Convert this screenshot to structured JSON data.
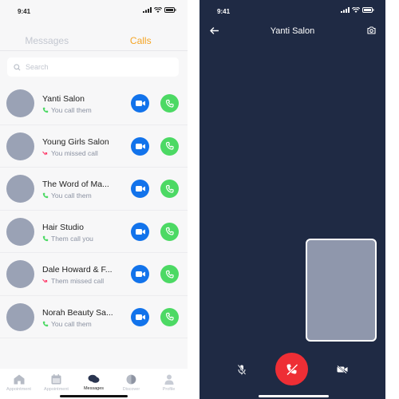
{
  "left_screen": {
    "status_time": "9:41",
    "tabs": [
      {
        "label": "Messages",
        "active": false
      },
      {
        "label": "Calls",
        "active": true
      }
    ],
    "search": {
      "placeholder": "Search",
      "value": ""
    },
    "calls": [
      {
        "name": "Yanti Salon",
        "status": "You call them",
        "direction": "outgoing"
      },
      {
        "name": "Young Girls Salon",
        "status": "You missed call",
        "direction": "missed"
      },
      {
        "name": "The Word of Ma...",
        "status": "You call them",
        "direction": "outgoing"
      },
      {
        "name": "Hair Studio",
        "status": "Them call you",
        "direction": "incoming"
      },
      {
        "name": "Dale Howard & F...",
        "status": "Them missed call",
        "direction": "missed"
      },
      {
        "name": "Norah Beauty Sa...",
        "status": "You call them",
        "direction": "outgoing"
      }
    ],
    "bottom_nav": [
      {
        "label": "Appointment",
        "icon": "home-icon",
        "active": false
      },
      {
        "label": "Appointment",
        "icon": "calendar-icon",
        "active": false
      },
      {
        "label": "Messages",
        "icon": "chat-icon",
        "active": true
      },
      {
        "label": "Discover",
        "icon": "compass-icon",
        "active": false
      },
      {
        "label": "Profile",
        "icon": "person-icon",
        "active": false
      }
    ]
  },
  "right_screen": {
    "status_time": "9:41",
    "title": "Yanti Salon"
  },
  "colors": {
    "accent": "#f5a524",
    "video_button": "#1273eb",
    "phone_button": "#4cd964",
    "end_call": "#ee2e35",
    "call_bg": "#1f2a44",
    "avatar": "#9aa2b5",
    "outgoing_icon": "#4cd964",
    "missed_icon": "#ff3b6b"
  }
}
